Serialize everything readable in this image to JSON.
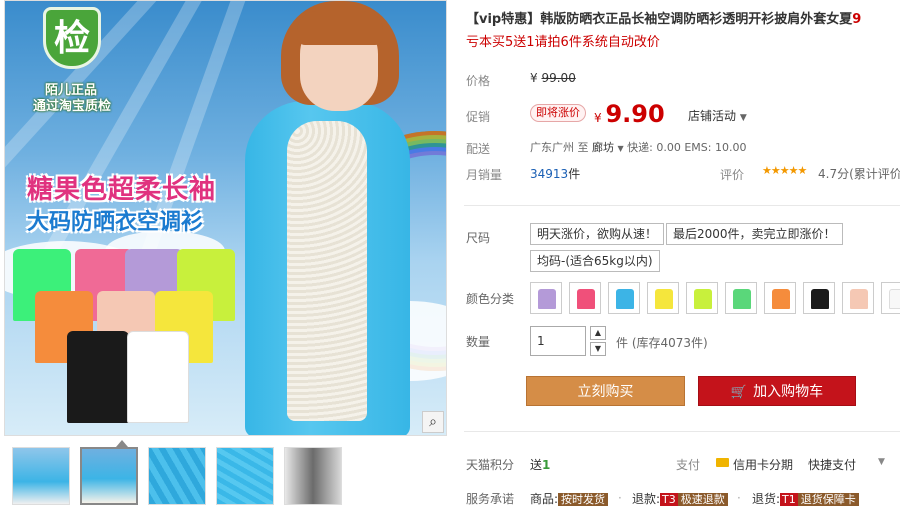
{
  "gallery": {
    "badge_char": "检",
    "badge_line1": "陌儿正品",
    "badge_line2": "通过淘宝质检",
    "promo_line1": "糖果色超柔长袖",
    "promo_line2": "大码防晒衣空调衫",
    "zoom_icon": "magnifier-icon",
    "thumbnails": [
      "thumb-1",
      "thumb-2",
      "thumb-3",
      "thumb-4",
      "thumb-5"
    ],
    "active_thumbnail": 2
  },
  "product": {
    "title_prefix": "【vip特惠】",
    "title_main": "韩版防晒衣正品长袖空调防晒衫透明开衫披肩外套女夏",
    "title_overflow": "9",
    "subtitle": "亏本买5送1请拍6件系统自动改价"
  },
  "price": {
    "label": "价格",
    "currency": "¥",
    "original": "99.00",
    "promo_label": "促销",
    "promo_tag": "即将涨价",
    "current": "9.90",
    "store_activity": "店铺活动"
  },
  "shipping": {
    "label": "配送",
    "from": "广东广州",
    "to_word": "至",
    "to": "廊坊",
    "details": "快递: 0.00 EMS: 10.00"
  },
  "sales": {
    "label": "月销量",
    "count": "34913",
    "unit": "件",
    "rating_label": "评价",
    "stars": "★★★★★",
    "rating_score": "4.7分",
    "rating_extra": "(累计评价"
  },
  "size": {
    "label": "尺码",
    "options": [
      "明天涨价，欲购从速！",
      "最后2000件，卖完立即涨价！",
      "均码-(适合65kg以内)"
    ]
  },
  "colors": {
    "label": "颜色分类",
    "swatches": [
      "#b49ad8",
      "#f0507a",
      "#3cb4e6",
      "#f5e63c",
      "#c8f03c",
      "#5ad77a",
      "#f58c3c",
      "#1a1a1a",
      "#f5c8b4",
      "#f8f8f8"
    ]
  },
  "quantity": {
    "label": "数量",
    "value": "1",
    "up": "▲",
    "down": "▼",
    "unit_stock": "件 (库存4073件)"
  },
  "actions": {
    "buy": "立刻购买",
    "cart": "加入购物车"
  },
  "points": {
    "label": "天猫积分",
    "value_prefix": "送",
    "value": "1",
    "pay_label": "支付",
    "credit_installment": "信用卡分期",
    "quick_pay": "快捷支付"
  },
  "service": {
    "label": "服务承诺",
    "items": [
      {
        "prefix": "商品:",
        "tag": "按时发货",
        "tag_code": ""
      },
      {
        "prefix": "退款:",
        "tag": "极速退款",
        "tag_code": "T3"
      },
      {
        "prefix": "退货:",
        "tag": "退货保障卡",
        "tag_code": "T1"
      }
    ]
  }
}
